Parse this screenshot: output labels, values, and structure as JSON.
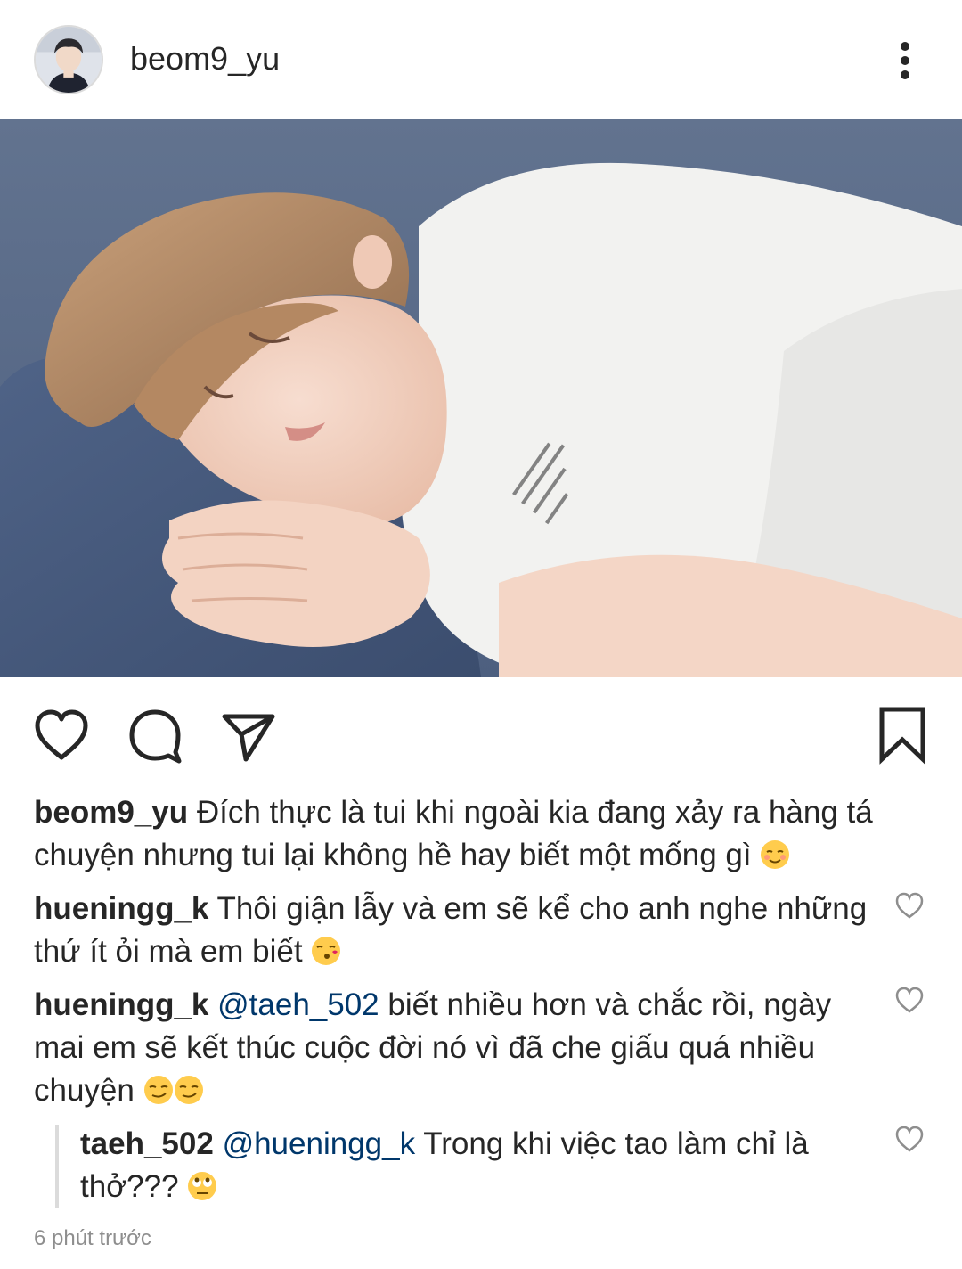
{
  "post": {
    "username": "beom9_yu",
    "caption_text": "Đích thực là tui khi ngoài kia đang xảy ra hàng tá chuyện nhưng tui lại không hề hay biết một mống gì",
    "caption_emoji": "relieved-face-emoji",
    "timestamp": "6 phút trước"
  },
  "icons": {
    "more": "more-vertical-icon",
    "like": "heart-icon",
    "comment": "comment-bubble-icon",
    "share": "paper-plane-icon",
    "save": "bookmark-icon",
    "comment_like": "heart-outline-icon"
  },
  "comments": [
    {
      "username": "hueningg_k",
      "text": "Thôi giận lẫy và em sẽ kể cho anh nghe những thứ ít ỏi mà em biết",
      "emoji": "kissing-face-emoji"
    },
    {
      "username": "hueningg_k",
      "mention": "@taeh_502",
      "text": "biết nhiều hơn và chắc rồi, ngày mai em sẽ kết thúc cuộc đời nó vì đã che giấu quá nhiều chuyện",
      "emoji": "smirking-face-emoji"
    },
    {
      "username": "taeh_502",
      "mention": "@hueningg_k",
      "text": "Trong khi việc tao làm chỉ là thở???",
      "emoji": "eye-roll-emoji",
      "is_reply": true
    }
  ],
  "colors": {
    "text": "#262626",
    "mention": "#00376b",
    "secondary": "#8e8e8e",
    "divider": "#dbdbdb"
  }
}
